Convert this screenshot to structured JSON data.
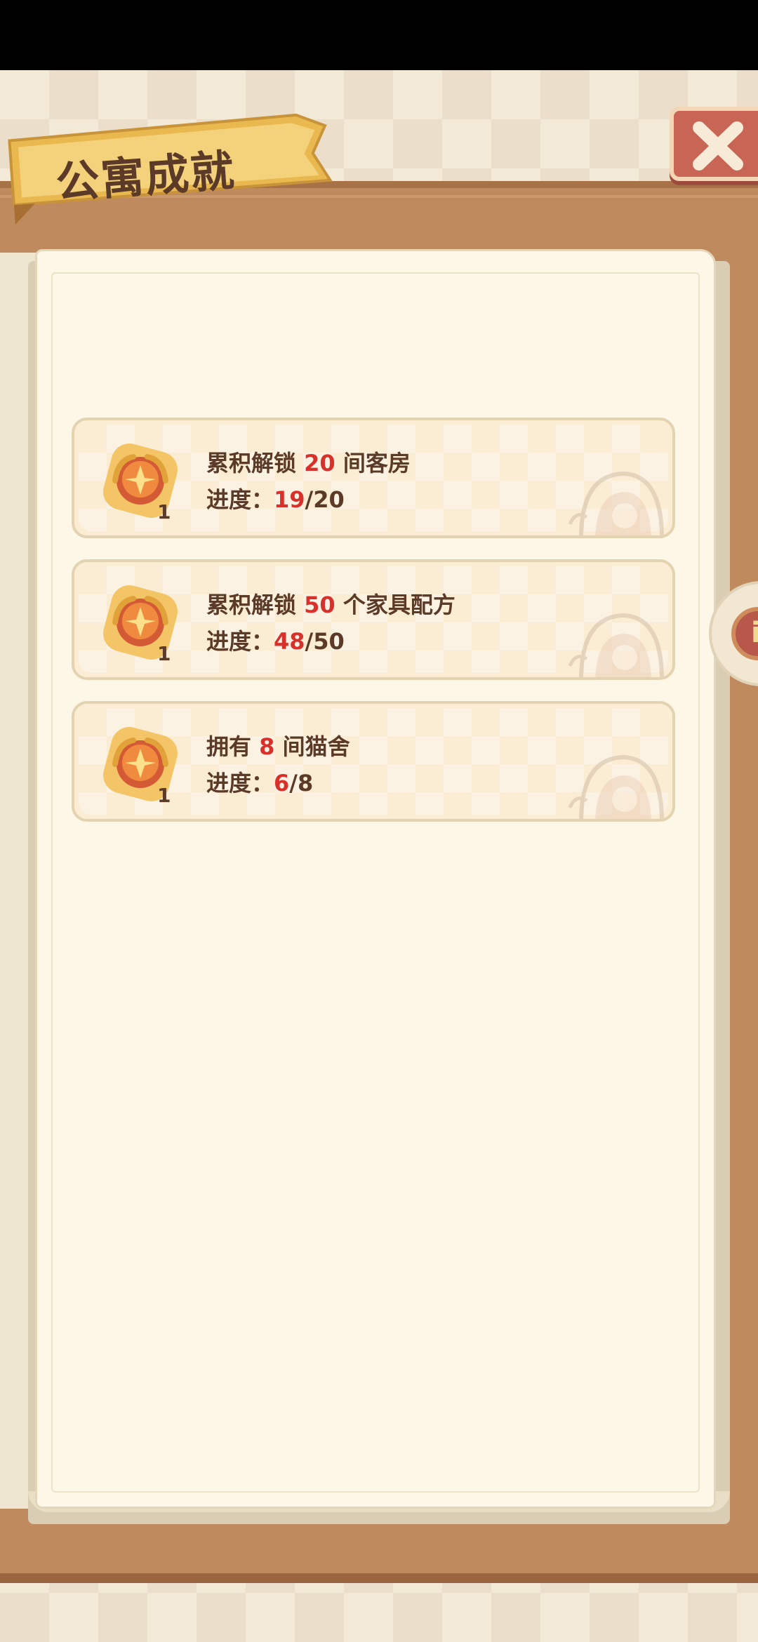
{
  "header": {
    "title": "公寓成就"
  },
  "side_tab": {
    "label": "i"
  },
  "achievements": [
    {
      "title_prefix": "累积解锁",
      "title_num": "20",
      "title_suffix": "间客房",
      "progress_label": "进度：",
      "progress_current": "19",
      "progress_sep": "/",
      "progress_total": "20",
      "reward_count": "1"
    },
    {
      "title_prefix": "累积解锁",
      "title_num": "50",
      "title_suffix": "个家具配方",
      "progress_label": "进度：",
      "progress_current": "48",
      "progress_sep": "/",
      "progress_total": "50",
      "reward_count": "1"
    },
    {
      "title_prefix": "拥有",
      "title_num": "8",
      "title_suffix": "间猫舍",
      "progress_label": "进度：",
      "progress_current": "6",
      "progress_sep": "/",
      "progress_total": "8",
      "reward_count": "1"
    }
  ],
  "colors": {
    "highlight": "#d8302b",
    "text": "#5b3a28",
    "wood": "#bf8a5d",
    "page": "#fdf7e8"
  },
  "icons": {
    "close": "close-icon",
    "medal": "medal-icon",
    "decoration": "cat-house-decoration"
  }
}
